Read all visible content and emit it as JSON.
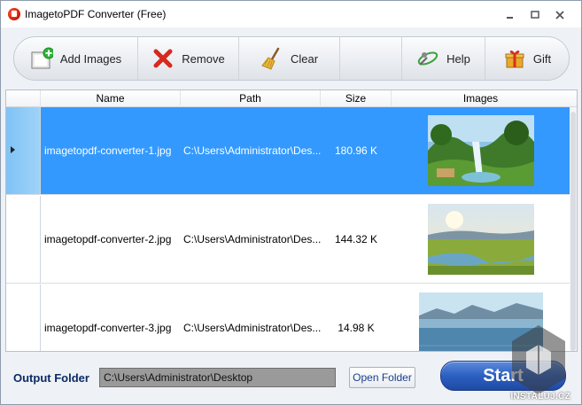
{
  "window": {
    "title": "ImagetoPDF Converter (Free)"
  },
  "toolbar": {
    "add_images": "Add Images",
    "remove": "Remove",
    "clear": "Clear",
    "help": "Help",
    "gift": "Gift"
  },
  "grid": {
    "columns": [
      "Name",
      "Path",
      "Size",
      "Images"
    ],
    "rows": [
      {
        "name": "imagetopdf-converter-1.jpg",
        "path": "C:\\Users\\Administrator\\Des...",
        "size": "180.96 K",
        "thumbnail": "forest-waterfall",
        "selected": true
      },
      {
        "name": "imagetopdf-converter-2.jpg",
        "path": "C:\\Users\\Administrator\\Des...",
        "size": "144.32 K",
        "thumbnail": "meadow-river",
        "selected": false
      },
      {
        "name": "imagetopdf-converter-3.jpg",
        "path": "C:\\Users\\Administrator\\Des...",
        "size": "14.98 K",
        "thumbnail": "lake-mountains",
        "selected": false
      }
    ]
  },
  "output": {
    "label": "Output Folder",
    "folder": "C:\\Users\\Administrator\\Desktop",
    "open_folder": "Open Folder",
    "start": "Start"
  },
  "watermark": {
    "text": "INSTALUJ.CZ"
  },
  "colors": {
    "selection": "#3399ff",
    "start_button": "#2c5fc2",
    "label": "#0c2a66"
  }
}
